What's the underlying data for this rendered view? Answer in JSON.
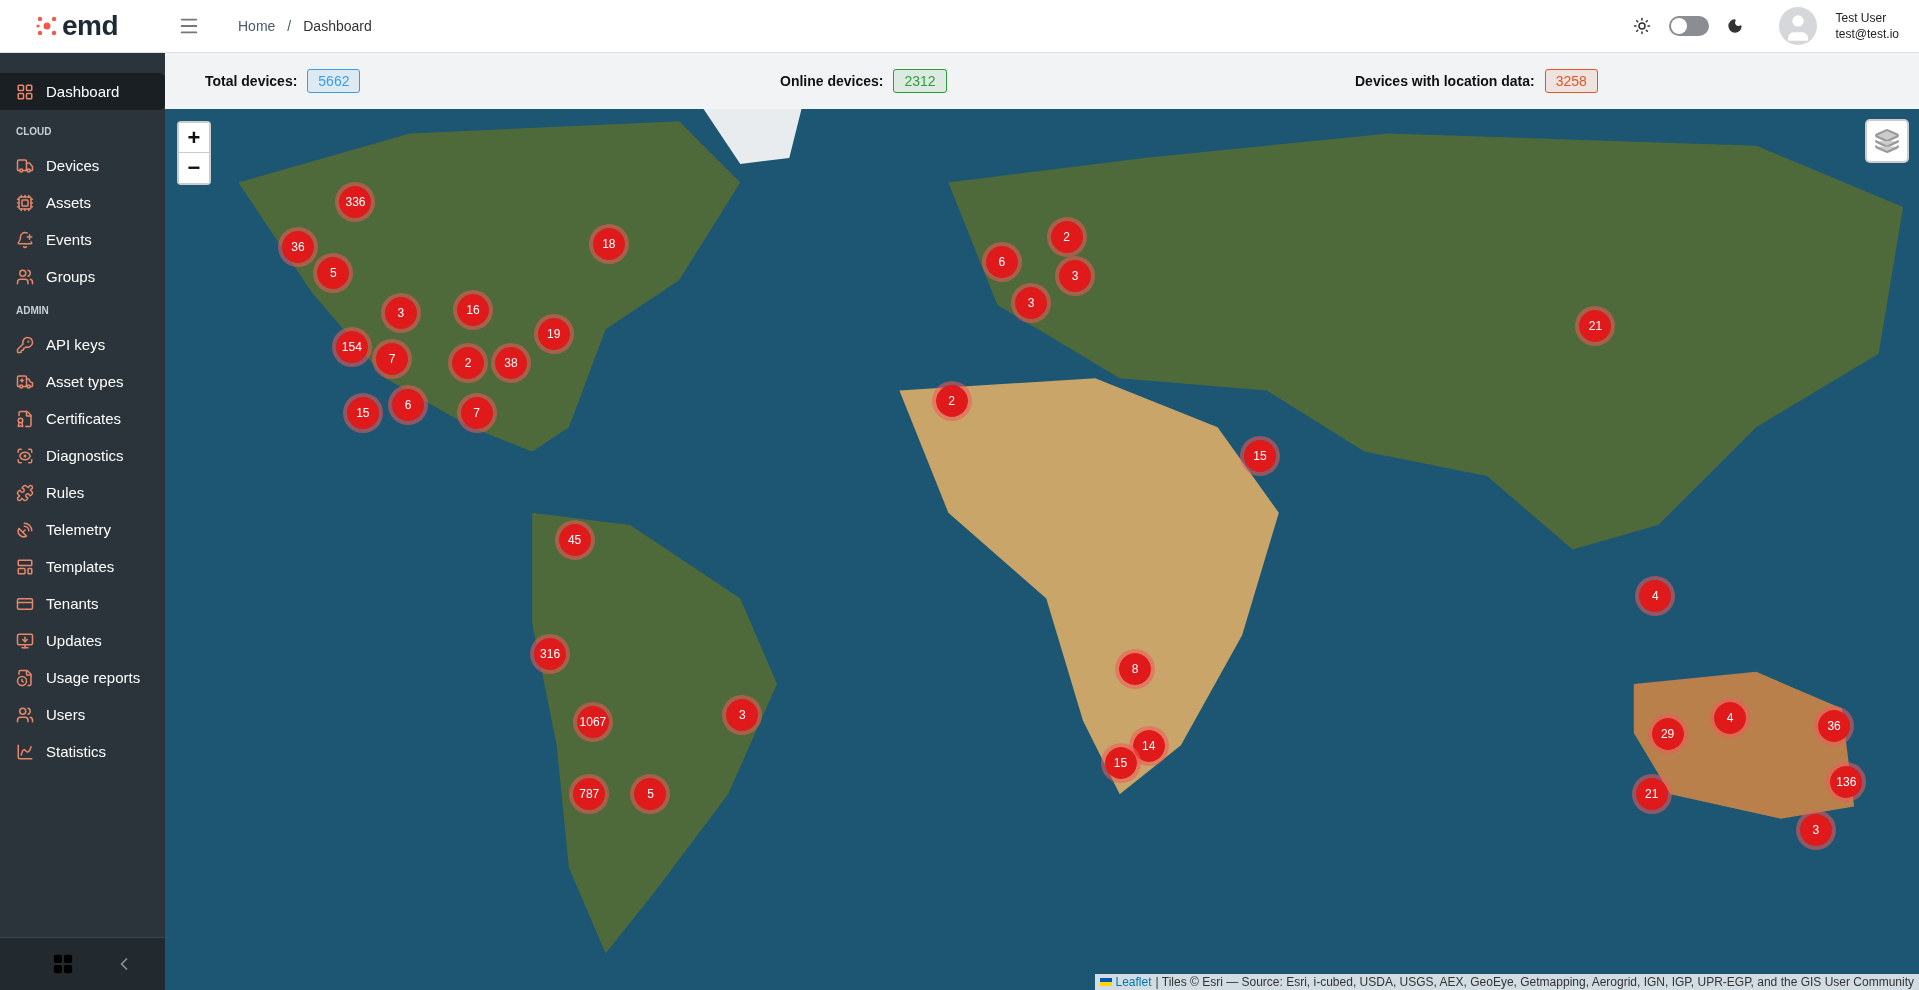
{
  "header": {
    "logo": "emd",
    "breadcrumb": [
      "Home",
      "Dashboard"
    ],
    "breadcrumb_separator": "/",
    "dark_mode": false,
    "user": {
      "name": "Test User",
      "email": "test@test.io"
    }
  },
  "sidebar": {
    "items": [
      {
        "kind": "item",
        "label": "Dashboard",
        "selected": true
      },
      {
        "kind": "section",
        "label": "CLOUD"
      },
      {
        "kind": "item",
        "label": "Devices",
        "selected": false
      },
      {
        "kind": "item",
        "label": "Assets",
        "selected": false
      },
      {
        "kind": "item",
        "label": "Events",
        "selected": false
      },
      {
        "kind": "item",
        "label": "Groups",
        "selected": false
      },
      {
        "kind": "section",
        "label": "ADMIN"
      },
      {
        "kind": "item",
        "label": "API keys",
        "selected": false
      },
      {
        "kind": "item",
        "label": "Asset types",
        "selected": false
      },
      {
        "kind": "item",
        "label": "Certificates",
        "selected": false
      },
      {
        "kind": "item",
        "label": "Diagnostics",
        "selected": false
      },
      {
        "kind": "item",
        "label": "Rules",
        "selected": false
      },
      {
        "kind": "item",
        "label": "Telemetry",
        "selected": false
      },
      {
        "kind": "item",
        "label": "Templates",
        "selected": false
      },
      {
        "kind": "item",
        "label": "Tenants",
        "selected": false
      },
      {
        "kind": "item",
        "label": "Updates",
        "selected": false
      },
      {
        "kind": "item",
        "label": "Usage reports",
        "selected": false
      },
      {
        "kind": "item",
        "label": "Users",
        "selected": false
      },
      {
        "kind": "item",
        "label": "Statistics",
        "selected": false
      }
    ]
  },
  "stats": [
    {
      "label": "Total devices:",
      "value": "5662",
      "color": "#3a9ee4"
    },
    {
      "label": "Online devices:",
      "value": "2312",
      "color": "#2e9e3a"
    },
    {
      "label": "Devices with location data:",
      "value": "3258",
      "color": "#e0562a"
    }
  ],
  "map": {
    "zoom_in": "+",
    "zoom_out": "−",
    "clusters": [
      {
        "label": "336"
      },
      {
        "label": "36"
      },
      {
        "label": "5"
      },
      {
        "label": "18"
      },
      {
        "label": "3"
      },
      {
        "label": "16"
      },
      {
        "label": "154"
      },
      {
        "label": "7"
      },
      {
        "label": "2"
      },
      {
        "label": "38"
      },
      {
        "label": "19"
      },
      {
        "label": "15"
      },
      {
        "label": "6"
      },
      {
        "label": "7"
      },
      {
        "label": "2"
      },
      {
        "label": "6"
      },
      {
        "label": "3"
      },
      {
        "label": "3"
      },
      {
        "label": "21"
      },
      {
        "label": "2"
      },
      {
        "label": "15"
      },
      {
        "label": "45"
      },
      {
        "label": "316"
      },
      {
        "label": "1067"
      },
      {
        "label": "3"
      },
      {
        "label": "787"
      },
      {
        "label": "5"
      },
      {
        "label": "8"
      },
      {
        "label": "14"
      },
      {
        "label": "15"
      },
      {
        "label": "4"
      },
      {
        "label": "29"
      },
      {
        "label": "4"
      },
      {
        "label": "36"
      },
      {
        "label": "136"
      },
      {
        "label": "21"
      },
      {
        "label": "3"
      }
    ],
    "attribution": {
      "link": "Leaflet",
      "text": "| Tiles © Esri — Source: Esri, i-cubed, USDA, USGS, AEX, GeoEye, Getmapping, Aerogrid, IGN, IGP, UPR-EGP, and the GIS User Community"
    }
  }
}
